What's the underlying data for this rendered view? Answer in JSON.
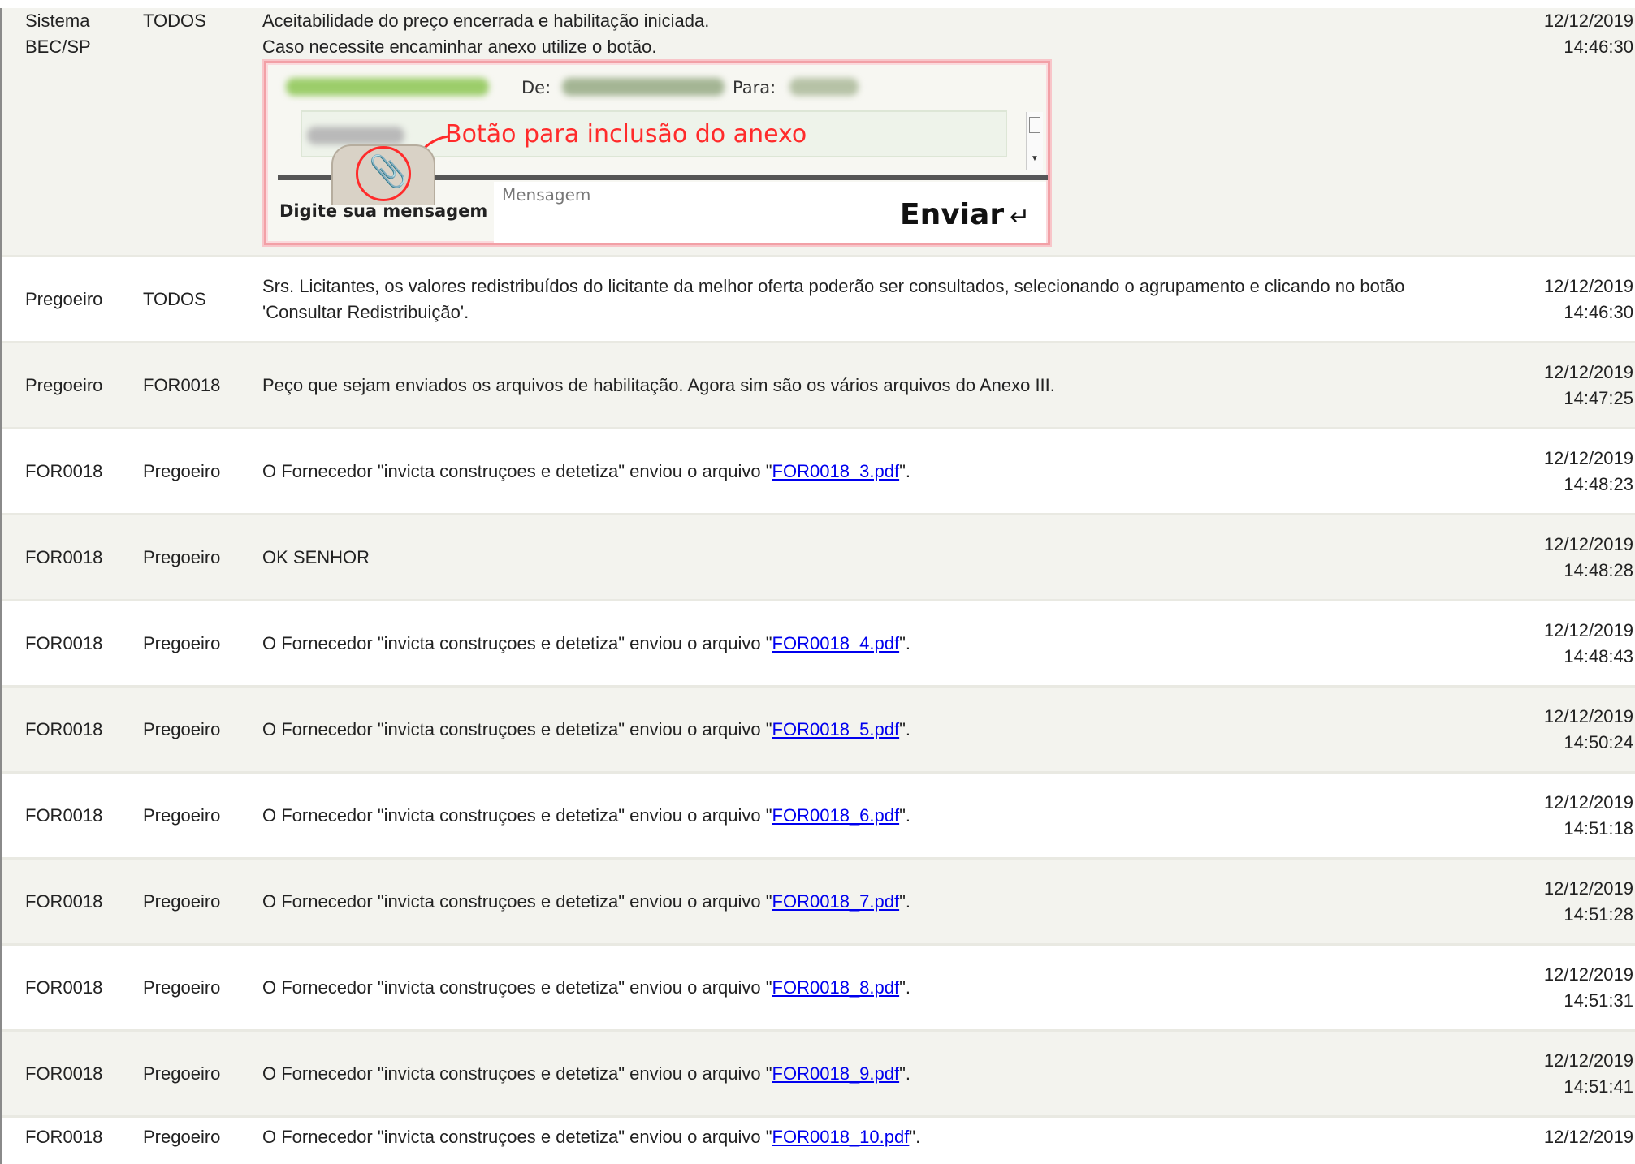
{
  "rows": [
    {
      "from": "Sistema BEC/SP",
      "to": "TODOS",
      "message_lines": [
        "Aceitabilidade do preço encerrada e habilitação iniciada.",
        "Caso necessite encaminhar anexo utilize o botão."
      ],
      "date": "12/12/2019",
      "time": "14:46:30",
      "embedded_image": {
        "de_label": "De:",
        "para_label": "Para:",
        "annotation": "Botão para inclusão do anexo",
        "tab_label": "Digite sua mensagem",
        "input_placeholder": "Mensagem",
        "send_label": "Enviar",
        "icons": [
          "paperclip-icon",
          "enter-key-icon"
        ]
      }
    },
    {
      "from": "Pregoeiro",
      "to": "TODOS",
      "message": "Srs. Licitantes, os valores redistribuídos do licitante da melhor oferta poderão ser consultados, selecionando o agrupamento e clicando no botão 'Consultar Redistribuição'.",
      "date": "12/12/2019",
      "time": "14:46:30"
    },
    {
      "from": "Pregoeiro",
      "to": "FOR0018",
      "message": "Peço que sejam enviados os arquivos de habilitação. Agora sim são os vários arquivos do Anexo III.",
      "date": "12/12/2019",
      "time": "14:47:25"
    },
    {
      "from": "FOR0018",
      "to": "Pregoeiro",
      "message_prefix": "O Fornecedor \"invicta construçoes e detetiza\" enviou o arquivo \"",
      "file": "FOR0018_3.pdf",
      "message_suffix": "\".",
      "date": "12/12/2019",
      "time": "14:48:23"
    },
    {
      "from": "FOR0018",
      "to": "Pregoeiro",
      "message": "OK SENHOR",
      "date": "12/12/2019",
      "time": "14:48:28"
    },
    {
      "from": "FOR0018",
      "to": "Pregoeiro",
      "message_prefix": "O Fornecedor \"invicta construçoes e detetiza\" enviou o arquivo \"",
      "file": "FOR0018_4.pdf",
      "message_suffix": "\".",
      "date": "12/12/2019",
      "time": "14:48:43"
    },
    {
      "from": "FOR0018",
      "to": "Pregoeiro",
      "message_prefix": "O Fornecedor \"invicta construçoes e detetiza\" enviou o arquivo \"",
      "file": "FOR0018_5.pdf",
      "message_suffix": "\".",
      "date": "12/12/2019",
      "time": "14:50:24"
    },
    {
      "from": "FOR0018",
      "to": "Pregoeiro",
      "message_prefix": "O Fornecedor \"invicta construçoes e detetiza\" enviou o arquivo \"",
      "file": "FOR0018_6.pdf",
      "message_suffix": "\".",
      "date": "12/12/2019",
      "time": "14:51:18"
    },
    {
      "from": "FOR0018",
      "to": "Pregoeiro",
      "message_prefix": "O Fornecedor \"invicta construçoes e detetiza\" enviou o arquivo \"",
      "file": "FOR0018_7.pdf",
      "message_suffix": "\".",
      "date": "12/12/2019",
      "time": "14:51:28"
    },
    {
      "from": "FOR0018",
      "to": "Pregoeiro",
      "message_prefix": "O Fornecedor \"invicta construçoes e detetiza\" enviou o arquivo \"",
      "file": "FOR0018_8.pdf",
      "message_suffix": "\".",
      "date": "12/12/2019",
      "time": "14:51:31"
    },
    {
      "from": "FOR0018",
      "to": "Pregoeiro",
      "message_prefix": "O Fornecedor \"invicta construçoes e detetiza\" enviou o arquivo \"",
      "file": "FOR0018_9.pdf",
      "message_suffix": "\".",
      "date": "12/12/2019",
      "time": "14:51:41"
    },
    {
      "from": "FOR0018",
      "to": "Pregoeiro",
      "message_prefix": "O Fornecedor \"invicta construçoes e detetiza\" enviou o arquivo \"",
      "file": "FOR0018_10.pdf",
      "message_suffix": "\".",
      "date": "12/12/2019"
    }
  ],
  "colors": {
    "row_shade": "#f3f3ee",
    "row_white": "#ffffff",
    "link": "#0000ee",
    "annotation_red": "#ff2b2b"
  }
}
